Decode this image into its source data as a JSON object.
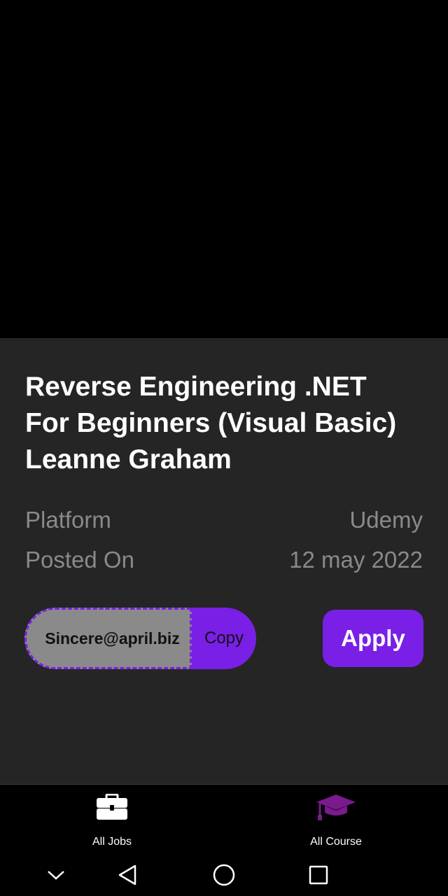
{
  "course": {
    "title_lines": [
      "Reverse Engineering .NET",
      "For Beginners (Visual Basic)",
      "Leanne Graham"
    ]
  },
  "details": {
    "platform_label": "Platform",
    "platform_value": "Udemy",
    "posted_label": "Posted On",
    "posted_value": "12 may 2022"
  },
  "coupon": {
    "code": "Sincere@april.biz",
    "copy_label": "Copy"
  },
  "apply_label": "Apply",
  "bottom_nav": {
    "items": [
      {
        "label": "All Jobs",
        "icon": "briefcase-icon"
      },
      {
        "label": "All Course",
        "icon": "graduation-cap-icon"
      }
    ]
  },
  "system_nav": {
    "icons": [
      "chevron-down-icon",
      "back-triangle-icon",
      "home-circle-icon",
      "recents-square-icon"
    ]
  },
  "colors": {
    "accent": "#7a1fe6",
    "sheet_bg": "#252525",
    "muted_text": "#8a8a8a",
    "cap_icon": "#7a1a8c"
  }
}
